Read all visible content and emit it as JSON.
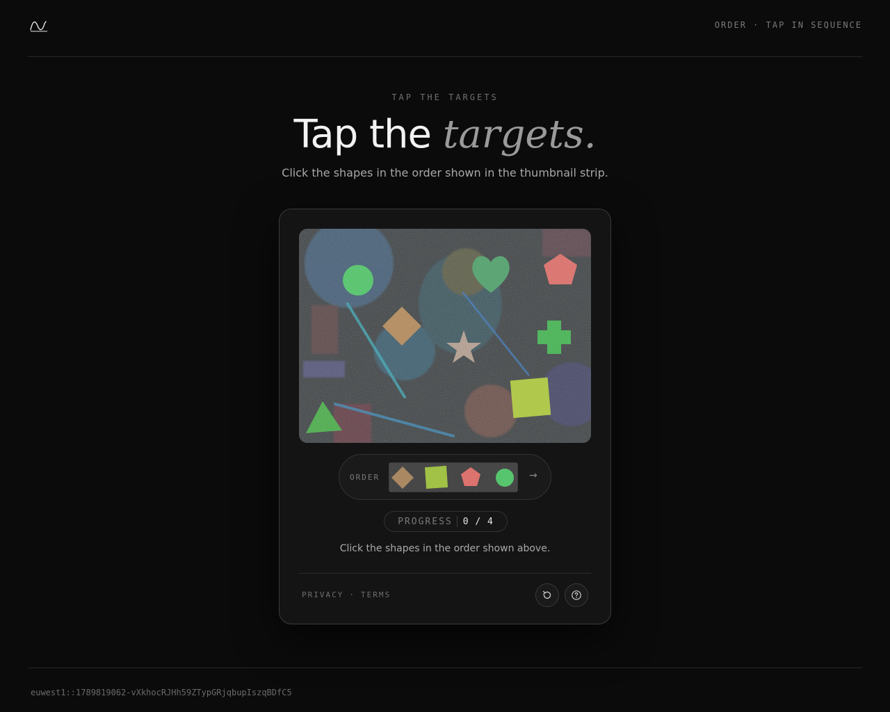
{
  "header": {
    "logo_icon": "wave-logo-icon",
    "mode_label": "ORDER · TAP IN SEQUENCE"
  },
  "hero": {
    "eyebrow": "TAP THE TARGETS",
    "title_plain": "Tap the",
    "title_accent": "targets.",
    "subtitle": "Click the shapes in the order shown in the thumbnail strip."
  },
  "challenge": {
    "canvas_shapes": [
      {
        "shape": "circle",
        "color": "#3ec45a"
      },
      {
        "shape": "heart",
        "color": "#3d9a5c"
      },
      {
        "shape": "pentagon",
        "color": "#e0605a"
      },
      {
        "shape": "diamond",
        "color": "#b0804a"
      },
      {
        "shape": "star",
        "color": "#b09888"
      },
      {
        "shape": "cross",
        "color": "#30b040"
      },
      {
        "shape": "square",
        "color": "#a8c828"
      },
      {
        "shape": "triangle",
        "color": "#38a838"
      }
    ],
    "order": {
      "label": "ORDER",
      "arrow": "→",
      "sequence": [
        {
          "shape": "diamond",
          "color": "#a37a4c"
        },
        {
          "shape": "square",
          "color": "#98bf2a"
        },
        {
          "shape": "pentagon",
          "color": "#e0605a"
        },
        {
          "shape": "circle",
          "color": "#3ec45a"
        }
      ]
    },
    "progress": {
      "label": "PROGRESS",
      "value": "0 / 4",
      "done": 0,
      "total": 4
    },
    "instruction": "Click the shapes in the order shown above.",
    "footer": {
      "privacy": "PRIVACY",
      "separator": "·",
      "terms": "TERMS",
      "refresh_icon": "refresh-icon",
      "help_icon": "help-icon"
    }
  },
  "session_id": "euwest1::1789819062-vXkhocRJHh59ZTypGRjqbupIszqBDfC5"
}
